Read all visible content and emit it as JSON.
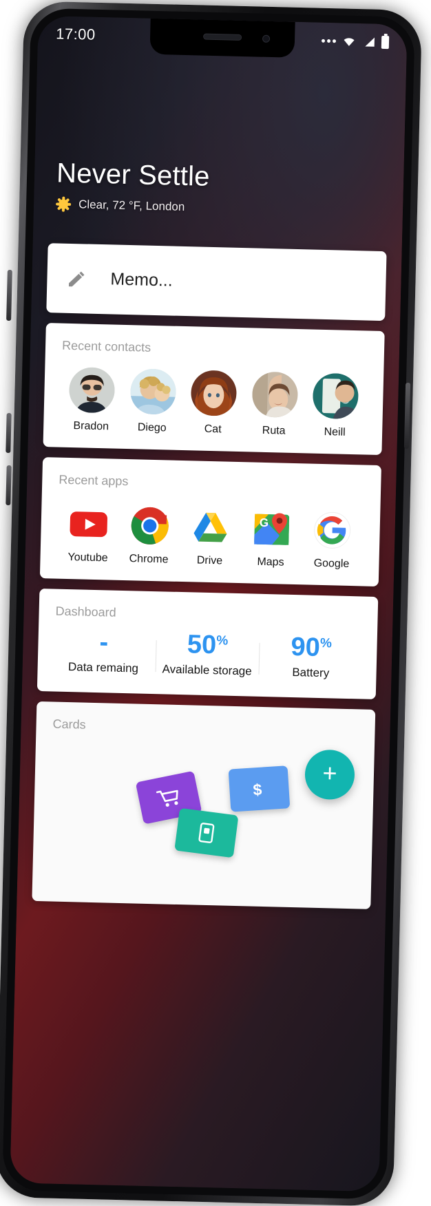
{
  "status_bar": {
    "time": "17:00",
    "icons": [
      "more-dots-icon",
      "wifi-icon",
      "signal-icon",
      "battery-icon"
    ]
  },
  "header": {
    "title": "Never Settle",
    "weather_icon": "sun-icon",
    "weather": "Clear, 72 °F, London"
  },
  "memo": {
    "icon": "pencil-icon",
    "placeholder": "Memo..."
  },
  "contacts": {
    "section_label": "Recent contacts",
    "items": [
      {
        "name": "Bradon"
      },
      {
        "name": "Diego"
      },
      {
        "name": "Cat"
      },
      {
        "name": "Ruta"
      },
      {
        "name": "Neill"
      }
    ]
  },
  "apps": {
    "section_label": "Recent apps",
    "items": [
      {
        "name": "Youtube",
        "icon": "youtube-icon"
      },
      {
        "name": "Chrome",
        "icon": "chrome-icon"
      },
      {
        "name": "Drive",
        "icon": "drive-icon"
      },
      {
        "name": "Maps",
        "icon": "maps-icon"
      },
      {
        "name": "Google",
        "icon": "google-icon"
      }
    ]
  },
  "dashboard": {
    "section_label": "Dashboard",
    "accent_color": "#2d93f0",
    "stats": [
      {
        "value": "-",
        "unit": "",
        "label": "Data remaing"
      },
      {
        "value": "50",
        "unit": "%",
        "label": "Available storage"
      },
      {
        "value": "90",
        "unit": "%",
        "label": "Battery"
      }
    ]
  },
  "cards": {
    "section_label": "Cards",
    "add_button_label": "+",
    "items": [
      {
        "icon": "shopping-cart-icon",
        "color": "#8b44d9"
      },
      {
        "icon": "dollar-icon",
        "color": "#5b9cf0"
      },
      {
        "icon": "wallet-icon",
        "color": "#1cb99c"
      }
    ]
  }
}
